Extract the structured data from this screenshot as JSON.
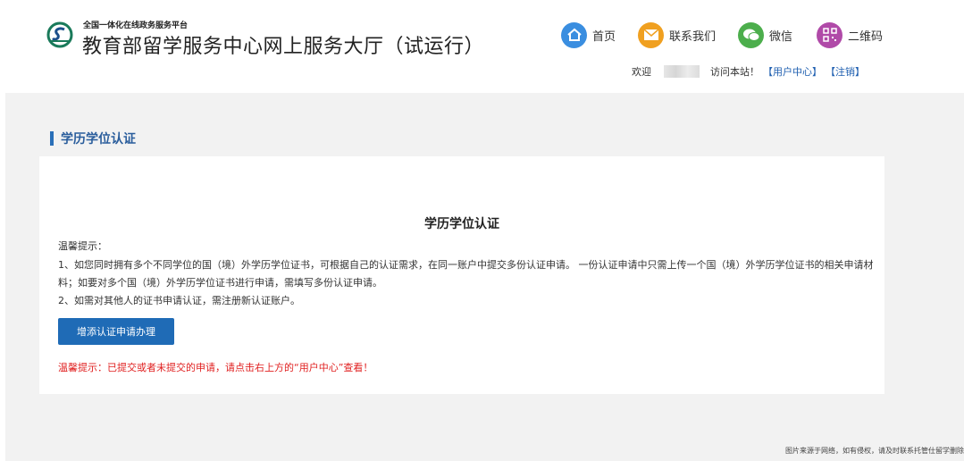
{
  "header": {
    "platform_label": "全国一体化在线政务服务平台",
    "site_title": "教育部留学服务中心网上服务大厅（试运行）",
    "nav": [
      {
        "label": "首页",
        "icon": "home-icon",
        "color": "#3a8ee0"
      },
      {
        "label": "联系我们",
        "icon": "mail-icon",
        "color": "#f0a020"
      },
      {
        "label": "微信",
        "icon": "wechat-icon",
        "color": "#4cae4c"
      },
      {
        "label": "二维码",
        "icon": "qrcode-icon",
        "color": "#b04aa8"
      }
    ],
    "welcome_prefix": "欢迎",
    "welcome_suffix": "访问本站！",
    "user_center": "【用户中心】",
    "logout": "【注销】"
  },
  "section": {
    "title": "学历学位认证"
  },
  "panel": {
    "title": "学历学位认证",
    "tip_label": "温馨提示：",
    "tip1": "1、如您同时拥有多个不同学位的国（境）外学历学位证书，可根据自己的认证需求，在同一账户中提交多份认证申请。 一份认证申请中只需上传一个国（境）外学历学位证书的相关申请材料；如要对多个国（境）外学历学位证书进行申请，需填写多份认证申请。",
    "tip2": "2、如需对其他人的证书申请认证，需注册新认证账户。",
    "apply_button": "增添认证申请办理",
    "red_tip": "温馨提示：已提交或者未提交的申请，请点击右上方的“用户中心”查看！"
  },
  "footer": {
    "note": "图片来源于网络，如有侵权，请及时联系托管仕留学删除"
  },
  "colors": {
    "accent": "#1f6bb6",
    "link": "#1f5fb0",
    "warning": "#e02020",
    "background": "#f2f2f2"
  }
}
